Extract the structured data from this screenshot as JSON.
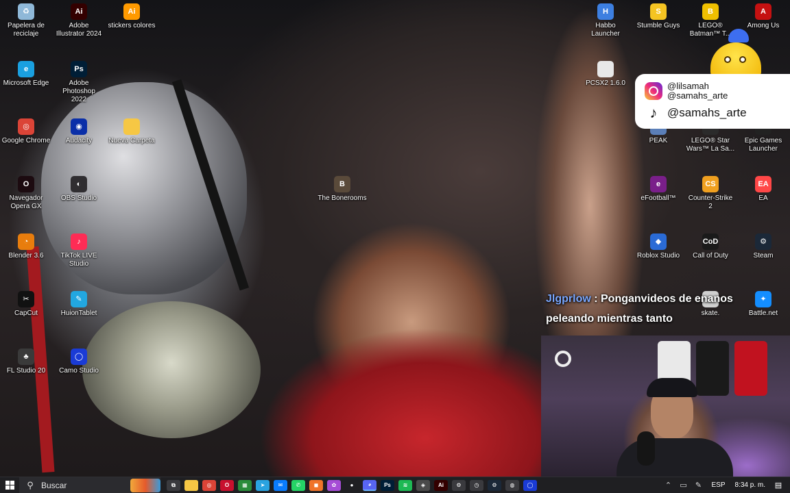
{
  "desktop": {
    "icons": [
      {
        "label": "Papelera de reciclaje",
        "icon": "recycle-bin-icon",
        "color": "#8fb8d8",
        "glyph": "♻"
      },
      {
        "label": "Adobe Illustrator 2024",
        "icon": "illustrator-icon",
        "color": "#330000",
        "glyph": "Ai"
      },
      {
        "label": "stickers colores",
        "icon": "illustrator-file-icon",
        "color": "#ff9a00",
        "glyph": "Ai"
      },
      {
        "label": "Microsoft Edge",
        "icon": "edge-icon",
        "color": "#1aa0e0",
        "glyph": "e"
      },
      {
        "label": "Adobe Photoshop 2022",
        "icon": "photoshop-icon",
        "color": "#001e36",
        "glyph": "Ps"
      },
      {
        "label": "Google Chrome",
        "icon": "chrome-icon",
        "color": "#db4437",
        "glyph": "◎"
      },
      {
        "label": "Audacity",
        "icon": "audacity-icon",
        "color": "#0a2fa8",
        "glyph": "◉"
      },
      {
        "label": "Nueva Carpeta",
        "icon": "folder-icon",
        "color": "#f6c744",
        "glyph": ""
      },
      {
        "label": "Navegador Opera GX",
        "icon": "opera-gx-icon",
        "color": "#1c0b10",
        "glyph": "O"
      },
      {
        "label": "OBS Studio",
        "icon": "obs-icon",
        "color": "#302e31",
        "glyph": "◐"
      },
      {
        "label": "The Bonerooms",
        "icon": "game-icon",
        "color": "#5a4a3a",
        "glyph": "B"
      },
      {
        "label": "Blender 3.6",
        "icon": "blender-icon",
        "color": "#e87d0d",
        "glyph": "◔"
      },
      {
        "label": "TikTok LIVE Studio",
        "icon": "tiktok-live-icon",
        "color": "#fe2c55",
        "glyph": "♪"
      },
      {
        "label": "CapCut",
        "icon": "capcut-icon",
        "color": "#111111",
        "glyph": "✂"
      },
      {
        "label": "HuionTablet",
        "icon": "huion-icon",
        "color": "#22a7e0",
        "glyph": "✎"
      },
      {
        "label": "FL Studio 20",
        "icon": "fl-studio-icon",
        "color": "#3a3a3a",
        "glyph": "♣"
      },
      {
        "label": "Camo Studio",
        "icon": "camo-icon",
        "color": "#1a3bd6",
        "glyph": "◯"
      },
      {
        "label": "Habbo Launcher",
        "icon": "habbo-icon",
        "color": "#3d7fe0",
        "glyph": "H"
      },
      {
        "label": "Stumble Guys",
        "icon": "stumble-guys-icon",
        "color": "#f5c422",
        "glyph": "S"
      },
      {
        "label": "LEGO® Batman™ T...",
        "icon": "lego-batman-icon",
        "color": "#f0c000",
        "glyph": "B"
      },
      {
        "label": "Among Us",
        "icon": "among-us-icon",
        "color": "#c51111",
        "glyph": "A"
      },
      {
        "label": "PCSX2 1.6.0",
        "icon": "file-icon",
        "color": "#e8e8e8",
        "glyph": ""
      },
      {
        "label": "PEAK",
        "icon": "peak-icon",
        "color": "#5b7fb8",
        "glyph": "P"
      },
      {
        "label": "LEGO® Star Wars™ La Sa...",
        "icon": "lego-starwars-icon",
        "color": "#2b2b2b",
        "glyph": "L"
      },
      {
        "label": "Epic Games Launcher",
        "icon": "epic-games-icon",
        "color": "#222222",
        "glyph": "E"
      },
      {
        "label": "eFootball™",
        "icon": "efootball-icon",
        "color": "#7a1f8a",
        "glyph": "e"
      },
      {
        "label": "Counter-Strike 2",
        "icon": "counter-strike-icon",
        "color": "#f0a020",
        "glyph": "CS"
      },
      {
        "label": "EA",
        "icon": "ea-icon",
        "color": "#ff4747",
        "glyph": "EA"
      },
      {
        "label": "Roblox Studio",
        "icon": "roblox-studio-icon",
        "color": "#2a6bd6",
        "glyph": "◆"
      },
      {
        "label": "Call of Duty",
        "icon": "call-of-duty-icon",
        "color": "#1a1a1a",
        "glyph": "CoD"
      },
      {
        "label": "Steam",
        "icon": "steam-icon",
        "color": "#1b2838",
        "glyph": "⚙"
      },
      {
        "label": "skate.",
        "icon": "skate-icon",
        "color": "#d0d0d0",
        "glyph": "s"
      },
      {
        "label": "Battle.net",
        "icon": "battle-net-icon",
        "color": "#148eff",
        "glyph": "✦"
      }
    ]
  },
  "overlay": {
    "instagram_handle_1": "@lilsamah",
    "instagram_handle_2": "@samahs_arte",
    "tiktok_handle": "@samahs_arte",
    "instagram_icon": "instagram-icon",
    "tiktok_icon": "tiktok-icon"
  },
  "chat": {
    "username": "Jlgprlow",
    "separator": " : ",
    "message": "Ponganvideos de enanos peleando mientras tanto"
  },
  "taskbar": {
    "search_placeholder": "Buscar",
    "pinned": [
      {
        "icon": "task-view-icon",
        "color": "#3a3a3e",
        "glyph": "⧉"
      },
      {
        "icon": "file-explorer-icon",
        "color": "#f6c744",
        "glyph": ""
      },
      {
        "icon": "chrome-icon",
        "color": "#db4437",
        "glyph": "◎"
      },
      {
        "icon": "opera-gx-icon",
        "color": "#c8102e",
        "glyph": "O"
      },
      {
        "icon": "store-icon",
        "color": "#2a8c3a",
        "glyph": "▦"
      },
      {
        "icon": "telegram-icon",
        "color": "#2aa3e0",
        "glyph": "➤"
      },
      {
        "icon": "messenger-icon",
        "color": "#0a7cff",
        "glyph": "✉"
      },
      {
        "icon": "whatsapp-icon",
        "color": "#25d366",
        "glyph": "✆"
      },
      {
        "icon": "app-orange-icon",
        "color": "#f0742a",
        "glyph": "◼"
      },
      {
        "icon": "app-colorful-icon",
        "color": "#a64dd6",
        "glyph": "✿"
      },
      {
        "icon": "record-icon",
        "color": "#1f1f22",
        "glyph": "●"
      },
      {
        "icon": "discord-icon",
        "color": "#5865f2",
        "glyph": "◕"
      },
      {
        "icon": "photoshop-icon",
        "color": "#001e36",
        "glyph": "Ps"
      },
      {
        "icon": "spotify-icon",
        "color": "#1db954",
        "glyph": "≋"
      },
      {
        "icon": "game-icon",
        "color": "#4a4a4a",
        "glyph": "◈"
      },
      {
        "icon": "illustrator-icon",
        "color": "#330000",
        "glyph": "Ai"
      },
      {
        "icon": "settings-icon",
        "color": "#3a3a3e",
        "glyph": "⚙"
      },
      {
        "icon": "clock-icon",
        "color": "#3a3a3e",
        "glyph": "◷"
      },
      {
        "icon": "steam-icon",
        "color": "#1b2838",
        "glyph": "⚙"
      },
      {
        "icon": "app-dark-icon",
        "color": "#3a3a3e",
        "glyph": "◍"
      },
      {
        "icon": "camo-icon",
        "color": "#1a3bd6",
        "glyph": "◯"
      }
    ],
    "tray": {
      "chevron_icon": "chevron-up-icon",
      "network_icon": "network-icon",
      "pen_icon": "pen-icon",
      "language": "ESP",
      "time": "8:34 p. m.",
      "notification_icon": "notification-icon"
    }
  }
}
